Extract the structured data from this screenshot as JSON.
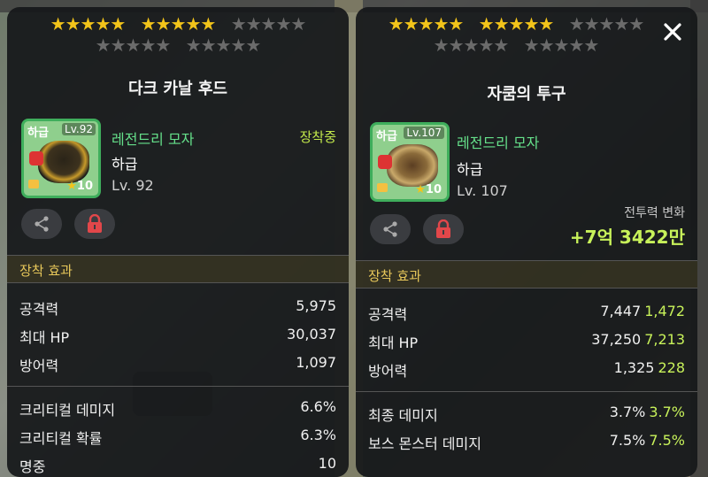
{
  "left": {
    "stars": {
      "filled": 10,
      "total": 25
    },
    "title": "다크 카날 후드",
    "item": {
      "grade": "하급",
      "level_tag": "Lv.92",
      "star_count": "10",
      "name": "레전드리 모자",
      "rank": "하급",
      "level": "Lv. 92",
      "equipped": "장착중"
    },
    "section": "장착 효과",
    "stats": [
      {
        "label": "공격력",
        "value": "5,975"
      },
      {
        "label": "최대 HP",
        "value": "30,037"
      },
      {
        "label": "방어력",
        "value": "1,097"
      }
    ],
    "stats2": [
      {
        "label": "크리티컬 데미지",
        "value": "6.6%"
      },
      {
        "label": "크리티컬 확률",
        "value": "6.3%"
      },
      {
        "label": "명중",
        "value": "10"
      }
    ]
  },
  "right": {
    "stars": {
      "filled": 10,
      "total": 25
    },
    "title": "자쿰의 투구",
    "item": {
      "grade": "하급",
      "level_tag": "Lv.107",
      "star_count": "10",
      "name": "레전드리 모자",
      "rank": "하급",
      "level": "Lv. 107"
    },
    "cp_label": "전투력 변화",
    "cp_value": "+7억 3422만",
    "section": "장착 효과",
    "stats": [
      {
        "label": "공격력",
        "value": "7,447",
        "increase": "1,472"
      },
      {
        "label": "최대 HP",
        "value": "37,250",
        "increase": "7,213"
      },
      {
        "label": "방어력",
        "value": "1,325",
        "increase": "228"
      }
    ],
    "stats2": [
      {
        "label": "최종 데미지",
        "value": "3.7%",
        "increase": "3.7%"
      },
      {
        "label": "보스 몬스터 데미지",
        "value": "7.5%",
        "increase": "7.5%"
      }
    ]
  },
  "icons": {
    "share": "share-icon",
    "lock": "lock-icon",
    "close": "close-icon"
  },
  "colors": {
    "item_name": "#65e08a",
    "increase": "#c8f25a",
    "section": "#e8c85a",
    "star_on": "#f2c41a",
    "star_off": "#6b6b6b",
    "item_bg": "#8fcf8d"
  }
}
